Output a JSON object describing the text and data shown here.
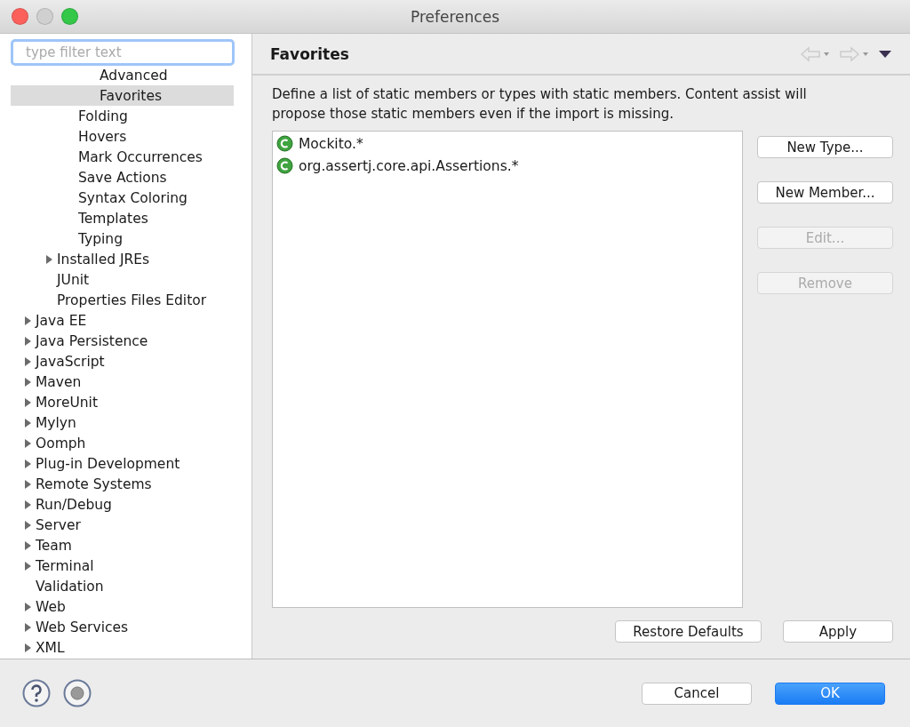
{
  "window": {
    "title": "Preferences"
  },
  "filter": {
    "placeholder": "type filter text"
  },
  "tree": [
    {
      "children": [
        {
          "children": [
            {
              "children": [
                {
                  "label": "Advanced",
                  "selected": false
                },
                {
                  "label": "Favorites",
                  "selected": true
                }
              ]
            },
            {
              "label": "Folding",
              "selected": false
            },
            {
              "label": "Hovers",
              "selected": false
            },
            {
              "label": "Mark Occurrences",
              "selected": false
            },
            {
              "label": "Save Actions",
              "selected": false
            },
            {
              "label": "Syntax Coloring",
              "selected": false
            },
            {
              "label": "Templates",
              "selected": false
            },
            {
              "label": "Typing",
              "selected": false
            }
          ]
        },
        {
          "label": "Installed JREs",
          "selected": false,
          "expanded": false
        },
        {
          "label": "JUnit",
          "selected": false
        },
        {
          "label": "Properties Files Editor",
          "selected": false
        }
      ]
    },
    {
      "label": "Java EE",
      "selected": false,
      "expanded": false
    },
    {
      "label": "Java Persistence",
      "selected": false,
      "expanded": false
    },
    {
      "label": "JavaScript",
      "selected": false,
      "expanded": false
    },
    {
      "label": "Maven",
      "selected": false,
      "expanded": false
    },
    {
      "label": "MoreUnit",
      "selected": false,
      "expanded": false
    },
    {
      "label": "Mylyn",
      "selected": false,
      "expanded": false
    },
    {
      "label": "Oomph",
      "selected": false,
      "expanded": false
    },
    {
      "label": "Plug-in Development",
      "selected": false,
      "expanded": false
    },
    {
      "label": "Remote Systems",
      "selected": false,
      "expanded": false
    },
    {
      "label": "Run/Debug",
      "selected": false,
      "expanded": false
    },
    {
      "label": "Server",
      "selected": false,
      "expanded": false
    },
    {
      "label": "Team",
      "selected": false,
      "expanded": false
    },
    {
      "label": "Terminal",
      "selected": false,
      "expanded": false
    },
    {
      "label": "Validation",
      "selected": false
    },
    {
      "label": "Web",
      "selected": false,
      "expanded": false
    },
    {
      "label": "Web Services",
      "selected": false,
      "expanded": false
    },
    {
      "label": "XML",
      "selected": false,
      "expanded": false
    }
  ],
  "page": {
    "title": "Favorites",
    "description": "Define a list of static members or types with static members. Content assist will propose those static members even if the import is missing.",
    "favorites": [
      "Mockito.*",
      "org.assertj.core.api.Assertions.*"
    ],
    "side_buttons": [
      {
        "label": "New Type...",
        "disabled": false
      },
      {
        "label": "New Member...",
        "disabled": false
      },
      {
        "label": "Edit...",
        "disabled": true
      },
      {
        "label": "Remove",
        "disabled": true
      }
    ],
    "bottom_buttons": [
      "Restore Defaults",
      "Apply"
    ]
  },
  "footer": {
    "buttons": [
      {
        "label": "Cancel",
        "kind": "secondary"
      },
      {
        "label": "OK",
        "kind": "default"
      }
    ]
  }
}
